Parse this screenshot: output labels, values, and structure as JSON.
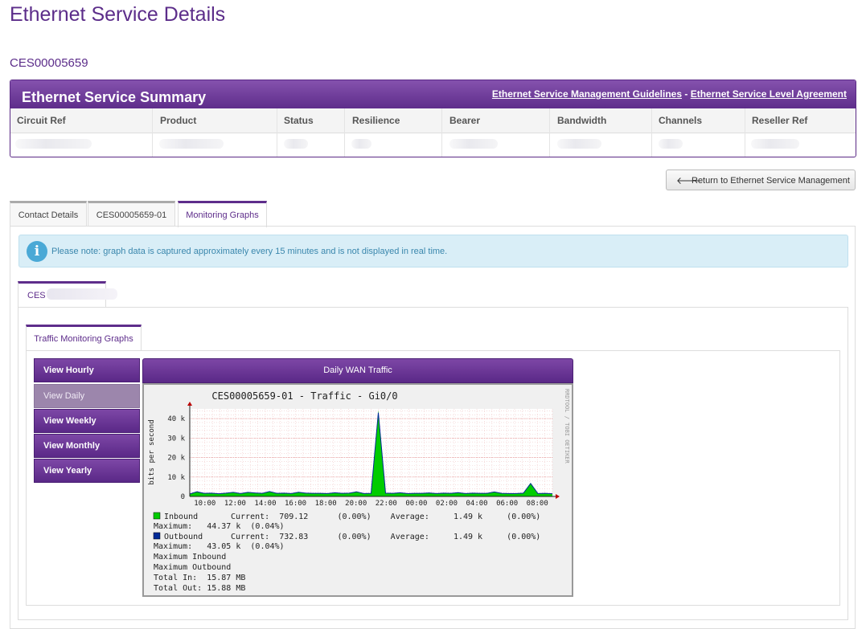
{
  "page": {
    "title": "Ethernet Service Details",
    "service_id": "CES00005659"
  },
  "summary": {
    "title": "Ethernet Service Summary",
    "link_guidelines": "Ethernet Service Management Guidelines",
    "link_separator": "-",
    "link_sla": "Ethernet Service Level Agreement",
    "columns": [
      "Circuit Ref",
      "Product",
      "Status",
      "Resilience",
      "Bearer",
      "Bandwidth",
      "Channels",
      "Reseller Ref"
    ]
  },
  "return_button": {
    "icon": "arrow-left-icon",
    "label": "Return to Ethernet Service Management"
  },
  "tabs": [
    {
      "label": "Contact Details",
      "active": false
    },
    {
      "label": "CES00005659-01",
      "active": false
    },
    {
      "label": "Monitoring Graphs",
      "active": true
    }
  ],
  "notice": {
    "icon": "info-icon",
    "icon_glyph": "i",
    "text": "Please note: graph data is captured approximately every 15 minutes and is not displayed in real time."
  },
  "interface_tab": {
    "label": "CES"
  },
  "traffic_tab": {
    "label": "Traffic Monitoring Graphs"
  },
  "menu": [
    {
      "label": "View Hourly",
      "selected": false
    },
    {
      "label": "View Daily",
      "selected": true
    },
    {
      "label": "View Weekly",
      "selected": false
    },
    {
      "label": "View Monthly",
      "selected": false
    },
    {
      "label": "View Yearly",
      "selected": false
    }
  ],
  "graph": {
    "header": "Daily WAN Traffic",
    "title": "CES00005659-01 - Traffic - Gi0/0",
    "side_text": "RRDTOOL / TOBI OETIKER",
    "ylabel": "bits per second",
    "legend": [
      "Current:  709.12      (0.00%)    Average:     1.49 k     (0.00%)",
      "Maximum:   44.37 k  (0.04%)",
      "Current:  732.83      (0.00%)    Average:     1.49 k     (0.00%)",
      "Maximum:   43.05 k  (0.04%)",
      "Maximum Inbound",
      "Maximum Outbound",
      "Total In:  15.87 MB",
      "Total Out: 15.88 MB"
    ],
    "inbound_label": "Inbound",
    "outbound_label": "Outbound",
    "inbound_color": "#00cc00",
    "outbound_color": "#002a97"
  },
  "chart_data": {
    "type": "area",
    "title": "CES00005659-01 - Traffic - Gi0/0",
    "ylabel": "bits per second",
    "xlabel": "",
    "ylim": [
      0,
      45000
    ],
    "yticks": [
      "0",
      "10 k",
      "20 k",
      "30 k",
      "40 k"
    ],
    "yticks_values": [
      0,
      10000,
      20000,
      30000,
      40000
    ],
    "xticks": [
      "10:00",
      "12:00",
      "14:00",
      "16:00",
      "18:00",
      "20:00",
      "22:00",
      "00:00",
      "02:00",
      "04:00",
      "06:00",
      "08:00"
    ],
    "x": [
      "09:00",
      "09:30",
      "10:00",
      "10:30",
      "11:00",
      "11:30",
      "12:00",
      "12:30",
      "13:00",
      "13:30",
      "14:00",
      "14:30",
      "15:00",
      "15:30",
      "16:00",
      "16:30",
      "17:00",
      "17:30",
      "18:00",
      "18:30",
      "19:00",
      "19:30",
      "20:00",
      "20:30",
      "21:00",
      "21:30",
      "21:45",
      "22:00",
      "22:30",
      "23:00",
      "23:30",
      "00:00",
      "00:30",
      "01:00",
      "01:30",
      "02:00",
      "02:30",
      "03:00",
      "03:30",
      "04:00",
      "04:30",
      "05:00",
      "05:30",
      "06:00",
      "06:30",
      "07:00",
      "07:30",
      "07:45",
      "08:00",
      "08:30",
      "09:00"
    ],
    "series": [
      {
        "name": "Inbound",
        "color": "#00cc00",
        "values": [
          1200,
          2500,
          1500,
          1800,
          1300,
          1600,
          2000,
          1400,
          2200,
          1700,
          1500,
          2600,
          1500,
          1800,
          1400,
          2300,
          1600,
          1500,
          1700,
          1400,
          2000,
          1500,
          1600,
          2500,
          1400,
          1500,
          44370,
          1800,
          1500,
          2000,
          1400,
          1700,
          1500,
          1900,
          1400,
          1600,
          1500,
          2100,
          1400,
          1800,
          1500,
          1700,
          2400,
          1500,
          1600,
          1400,
          1800,
          7000,
          1600,
          1500,
          1300
        ]
      },
      {
        "name": "Outbound",
        "color": "#002a97",
        "values": [
          1300,
          2400,
          1600,
          1700,
          1400,
          1700,
          2100,
          1500,
          2100,
          1800,
          1600,
          2500,
          1600,
          1700,
          1500,
          2200,
          1700,
          1600,
          1600,
          1500,
          1900,
          1600,
          1700,
          2400,
          1500,
          1600,
          43050,
          1700,
          1600,
          1900,
          1500,
          1600,
          1600,
          1800,
          1500,
          1700,
          1600,
          2000,
          1500,
          1700,
          1600,
          1600,
          2300,
          1600,
          1500,
          1500,
          1700,
          6600,
          1500,
          1600,
          1400
        ]
      }
    ]
  }
}
